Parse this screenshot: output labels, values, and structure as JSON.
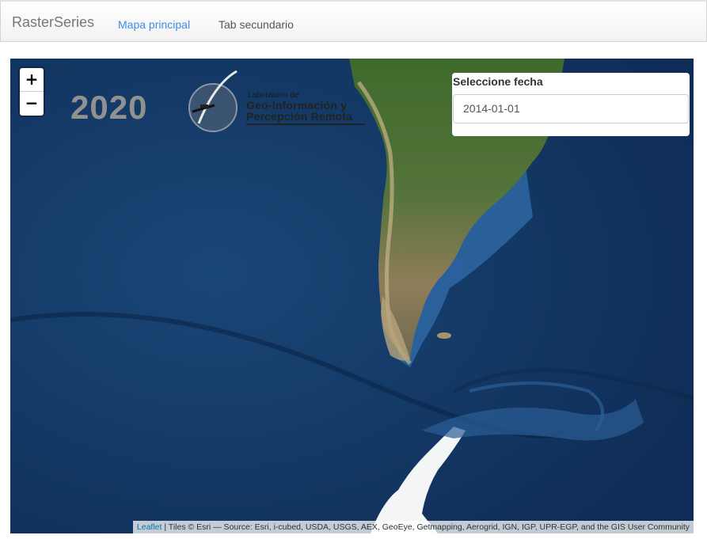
{
  "navbar": {
    "brand": "RasterSeries",
    "tabs": [
      {
        "label": "Mapa principal",
        "active": true
      },
      {
        "label": "Tab secundario",
        "active": false
      }
    ]
  },
  "map": {
    "basemap": "satellite imagery of South America and Antarctic Peninsula",
    "zoom_in_label": "+",
    "zoom_out_label": "−",
    "logo": {
      "year": "2020",
      "lab_small": "Laboratorio de",
      "lab_line1": "Geo-Información  y",
      "lab_line2": "Percepción Remota"
    },
    "date_panel": {
      "label": "Seleccione fecha",
      "value": "2014-01-01"
    },
    "attribution": {
      "link": "Leaflet",
      "text": " | Tiles © Esri — Source: Esri, i-cubed, USDA, USGS, AEX, GeoEye, Getmapping, Aerogrid, IGN, IGP, UPR-EGP, and the GIS User Community"
    }
  },
  "colors": {
    "ocean": "#153a66",
    "deep_ocean": "#0d2950",
    "shelf": "#2f6aa8",
    "land_green": "#4a6b2a",
    "land_desert": "#a89068",
    "ice": "#f4f6f8",
    "accent_link": "#3a8ee6"
  }
}
